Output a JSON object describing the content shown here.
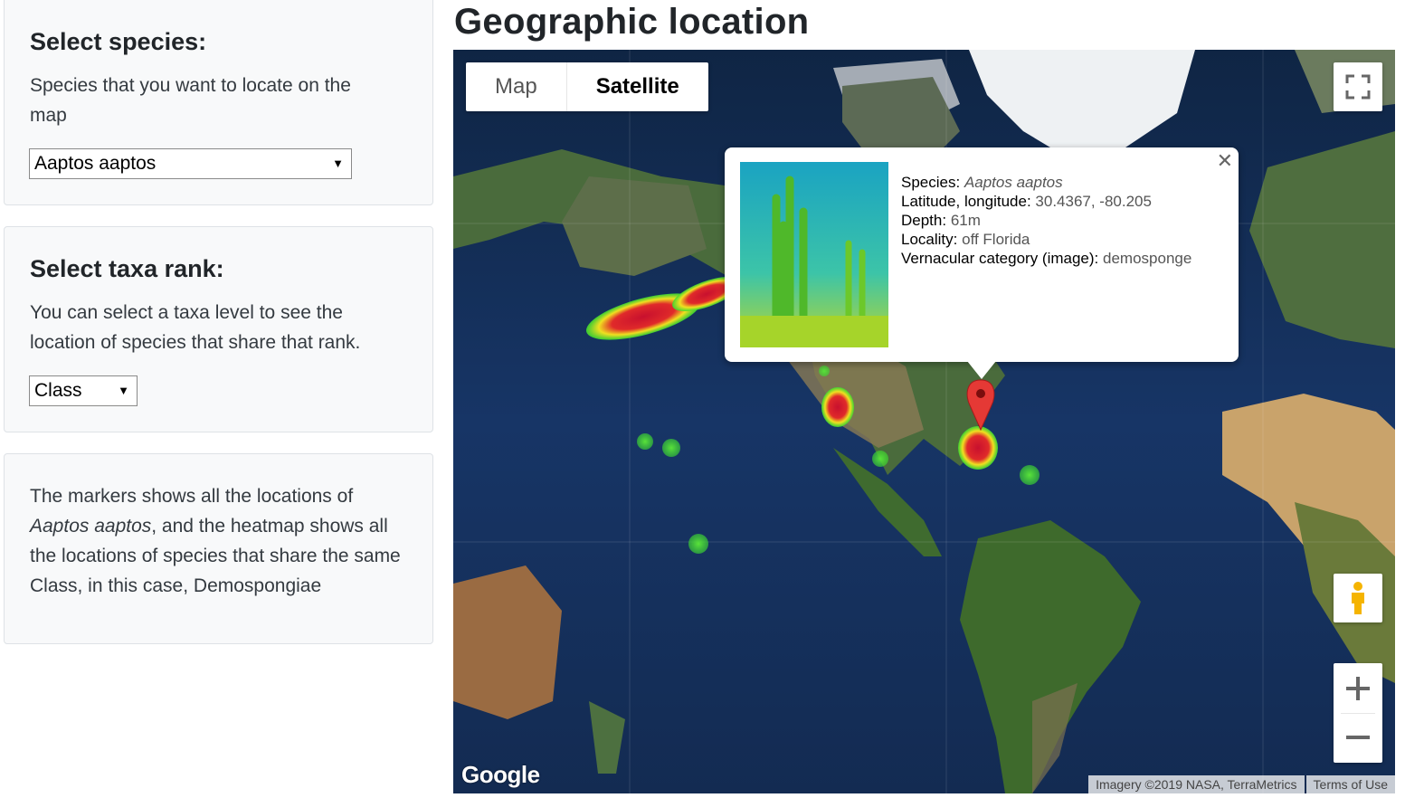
{
  "species_panel": {
    "title": "Select species:",
    "description": "Species that you want to locate on the map",
    "selected": "Aaptos aaptos"
  },
  "taxa_panel": {
    "title": "Select taxa rank:",
    "description": "You can select a taxa level to see the location of species that share that rank.",
    "selected": "Class"
  },
  "info_panel": {
    "text_1": "The markers shows all the locations of",
    "species": "Aaptos aaptos",
    "text_2": ", and the heatmap shows all the locations of species that share the same Class, in this case, Demospongiae"
  },
  "page_title": "Geographic location",
  "map": {
    "type_buttons": [
      "Map",
      "Satellite"
    ],
    "active_type": "Satellite",
    "icons": [
      "fullscreen-icon",
      "pegman-icon",
      "zoom-in-icon",
      "zoom-out-icon",
      "close-icon",
      "map-marker-icon"
    ],
    "google_logo": "Google",
    "attribution": "Imagery ©2019 NASA, TerraMetrics",
    "terms": "Terms of Use",
    "popup": {
      "species_label": "Species:",
      "species": "Aaptos aaptos",
      "latlng_label": "Latitude, longitude:",
      "latlng": "30.4367, -80.205",
      "depth_label": "Depth:",
      "depth": "61m",
      "locality_label": "Locality:",
      "locality": "off Florida",
      "vernacular_label": "Vernacular category (image):",
      "vernacular": "demosponge"
    },
    "colors": {
      "marker": "#e53935",
      "heat_hot": "#c8102e",
      "heat_cool": "#3ddc2f",
      "ocean": "#15305a"
    }
  }
}
